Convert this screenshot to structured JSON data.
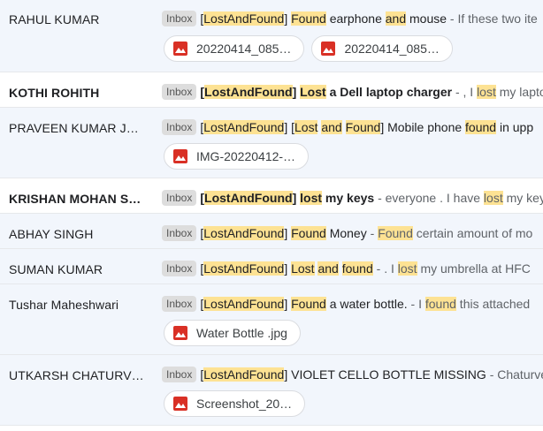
{
  "emails": [
    {
      "sender": "RAHUL KUMAR",
      "unread": false,
      "label": "Inbox",
      "subject_parts": [
        {
          "t": "[",
          "h": false
        },
        {
          "t": "LostAndFound",
          "h": true
        },
        {
          "t": "] ",
          "h": false
        },
        {
          "t": "Found",
          "h": true
        },
        {
          "t": " earphone ",
          "h": false
        },
        {
          "t": "and",
          "h": true
        },
        {
          "t": " mouse",
          "h": false
        }
      ],
      "snippet_parts": [
        {
          "t": " - If these two ite",
          "h": false
        }
      ],
      "attachments": [
        "20220414_085…",
        "20220414_085…"
      ]
    },
    {
      "sender": "KOTHI ROHITH",
      "unread": true,
      "label": "Inbox",
      "subject_parts": [
        {
          "t": "[",
          "h": false
        },
        {
          "t": "LostAndFound",
          "h": true
        },
        {
          "t": "] ",
          "h": false
        },
        {
          "t": "Lost",
          "h": true
        },
        {
          "t": " a Dell laptop charger",
          "h": false
        }
      ],
      "snippet_parts": [
        {
          "t": " - , I ",
          "h": false
        },
        {
          "t": "lost",
          "h": true
        },
        {
          "t": " my laptop",
          "h": false
        }
      ],
      "attachments": []
    },
    {
      "sender": "PRAVEEN KUMAR J…",
      "unread": false,
      "label": "Inbox",
      "subject_parts": [
        {
          "t": "[",
          "h": false
        },
        {
          "t": "LostAndFound",
          "h": true
        },
        {
          "t": "] [",
          "h": false
        },
        {
          "t": "Lost",
          "h": true
        },
        {
          "t": " ",
          "h": false
        },
        {
          "t": "and",
          "h": true
        },
        {
          "t": " ",
          "h": false
        },
        {
          "t": "Found",
          "h": true
        },
        {
          "t": "] Mobile phone ",
          "h": false
        },
        {
          "t": "found",
          "h": true
        },
        {
          "t": " in upp",
          "h": false
        }
      ],
      "snippet_parts": [],
      "attachments": [
        "IMG-20220412-…"
      ]
    },
    {
      "sender": "KRISHAN MOHAN S…",
      "unread": true,
      "label": "Inbox",
      "subject_parts": [
        {
          "t": "[",
          "h": false
        },
        {
          "t": "LostAndFound",
          "h": true
        },
        {
          "t": "] ",
          "h": false
        },
        {
          "t": "lost",
          "h": true
        },
        {
          "t": " my keys",
          "h": false
        }
      ],
      "snippet_parts": [
        {
          "t": " - everyone . I have ",
          "h": false
        },
        {
          "t": "lost",
          "h": true
        },
        {
          "t": " my keys",
          "h": false
        }
      ],
      "attachments": []
    },
    {
      "sender": "ABHAY SINGH",
      "unread": false,
      "label": "Inbox",
      "subject_parts": [
        {
          "t": "[",
          "h": false
        },
        {
          "t": "LostAndFound",
          "h": true
        },
        {
          "t": "] ",
          "h": false
        },
        {
          "t": "Found",
          "h": true
        },
        {
          "t": " Money",
          "h": false
        }
      ],
      "snippet_parts": [
        {
          "t": " - ",
          "h": false
        },
        {
          "t": "Found",
          "h": true
        },
        {
          "t": " certain amount of mo",
          "h": false
        }
      ],
      "attachments": []
    },
    {
      "sender": "SUMAN KUMAR",
      "unread": false,
      "label": "Inbox",
      "subject_parts": [
        {
          "t": "[",
          "h": false
        },
        {
          "t": "LostAndFound",
          "h": true
        },
        {
          "t": "] ",
          "h": false
        },
        {
          "t": "Lost",
          "h": true
        },
        {
          "t": " ",
          "h": false
        },
        {
          "t": "and",
          "h": true
        },
        {
          "t": " ",
          "h": false
        },
        {
          "t": "found",
          "h": true
        }
      ],
      "snippet_parts": [
        {
          "t": " - . I ",
          "h": false
        },
        {
          "t": "lost",
          "h": true
        },
        {
          "t": " my umbrella at HFC",
          "h": false
        }
      ],
      "attachments": []
    },
    {
      "sender": "Tushar Maheshwari",
      "unread": false,
      "label": "Inbox",
      "subject_parts": [
        {
          "t": "[",
          "h": false
        },
        {
          "t": "LostAndFound",
          "h": true
        },
        {
          "t": "] ",
          "h": false
        },
        {
          "t": "Found",
          "h": true
        },
        {
          "t": " a water bottle.",
          "h": false
        }
      ],
      "snippet_parts": [
        {
          "t": " - I ",
          "h": false
        },
        {
          "t": "found",
          "h": true
        },
        {
          "t": " this attached",
          "h": false
        }
      ],
      "attachments": [
        "Water Bottle .jpg"
      ]
    },
    {
      "sender": "UTKARSH CHATURV…",
      "unread": false,
      "label": "Inbox",
      "subject_parts": [
        {
          "t": "[",
          "h": false
        },
        {
          "t": "LostAndFound",
          "h": true
        },
        {
          "t": "] VIOLET CELLO BOTTLE MISSING",
          "h": false
        }
      ],
      "snippet_parts": [
        {
          "t": " - Chaturved",
          "h": false
        }
      ],
      "attachments": [
        "Screenshot_20…"
      ]
    }
  ],
  "colors": {
    "highlight": "#fde293",
    "read_row_bg": "#f2f6fc",
    "unread_row_bg": "#ffffff",
    "attachment_icon": "#d93025"
  },
  "icons": {
    "attachment": "image-icon"
  }
}
